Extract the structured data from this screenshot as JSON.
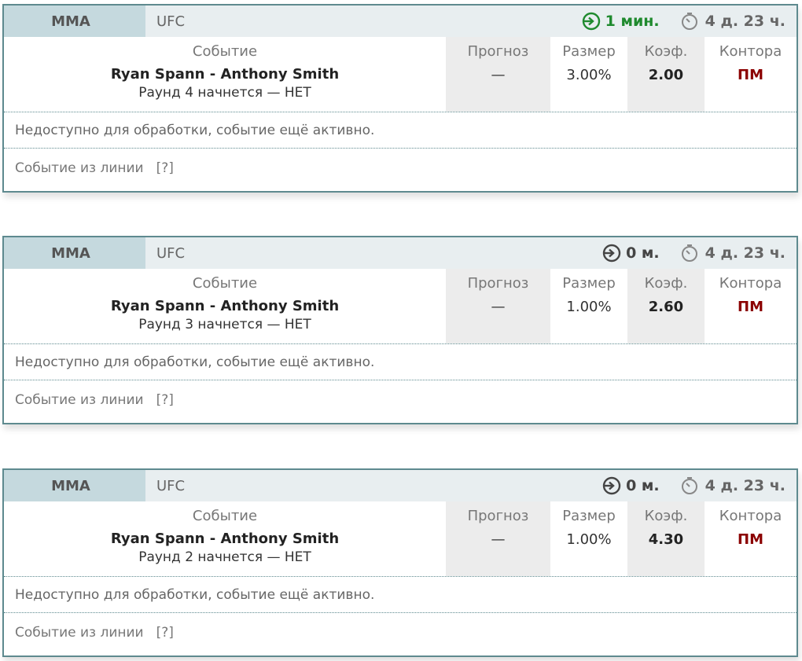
{
  "colors": {
    "border": "#5e8a8f",
    "header_bg": "#e8eef0",
    "sport_bg": "#c5d9de",
    "start_green": "#1f8a2e",
    "start_dark": "#444444",
    "office_red": "#8b0000"
  },
  "columns": {
    "event": "Событие",
    "forecast": "Прогноз",
    "size": "Размер",
    "coef": "Коэф.",
    "office": "Контора"
  },
  "cards": [
    {
      "sport": "MMA",
      "league": "UFC",
      "start": "1 мин.",
      "start_highlight": true,
      "duration": "4 д. 23 ч.",
      "event_name": "Ryan Spann - Anthony Smith",
      "event_sub": "Раунд 4 начнется — НЕТ",
      "forecast": "—",
      "size": "3.00%",
      "coef": "2.00",
      "office": "ПМ",
      "status": "Недоступно для обработки, событие ещё активно.",
      "source": "Событие из линии",
      "help": "[?]"
    },
    {
      "sport": "MMA",
      "league": "UFC",
      "start": "0 м.",
      "start_highlight": false,
      "duration": "4 д. 23 ч.",
      "event_name": "Ryan Spann - Anthony Smith",
      "event_sub": "Раунд 3 начнется — НЕТ",
      "forecast": "—",
      "size": "1.00%",
      "coef": "2.60",
      "office": "ПМ",
      "status": "Недоступно для обработки, событие ещё активно.",
      "source": "Событие из линии",
      "help": "[?]"
    },
    {
      "sport": "MMA",
      "league": "UFC",
      "start": "0 м.",
      "start_highlight": false,
      "duration": "4 д. 23 ч.",
      "event_name": "Ryan Spann - Anthony Smith",
      "event_sub": "Раунд 2 начнется — НЕТ",
      "forecast": "—",
      "size": "1.00%",
      "coef": "4.30",
      "office": "ПМ",
      "status": "Недоступно для обработки, событие ещё активно.",
      "source": "Событие из линии",
      "help": "[?]"
    }
  ]
}
